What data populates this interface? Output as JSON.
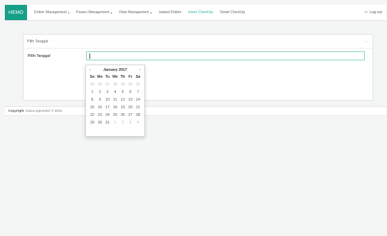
{
  "navbar": {
    "brand": "HEMO",
    "items": [
      {
        "label": "Dokter Management",
        "dropdown": true
      },
      {
        "label": "Pasien Management",
        "dropdown": true
      },
      {
        "label": "Obat Management",
        "dropdown": true
      },
      {
        "label": "Jadwal Dokter",
        "dropdown": false
      },
      {
        "label": "Insert CheckUp",
        "dropdown": false,
        "active": true
      },
      {
        "label": "Detail CheckUp",
        "dropdown": false
      }
    ],
    "caret": "▾",
    "logout": {
      "label": "Log out",
      "icon": "logout-icon",
      "glyph": "⇨"
    }
  },
  "panel": {
    "title": "Pilih Tanggal",
    "collapse_glyph": "︿",
    "field_label": "Pilih Tanggal",
    "field_value": ""
  },
  "datepicker": {
    "month_label": "January 2017",
    "prev": "‹",
    "next": "›",
    "dow": [
      "Su",
      "Mo",
      "Tu",
      "We",
      "Th",
      "Fr",
      "Sa"
    ],
    "weeks": [
      [
        "25",
        "26",
        "27",
        "28",
        "29",
        "30",
        "31"
      ],
      [
        "1",
        "2",
        "3",
        "4",
        "5",
        "6",
        "7"
      ],
      [
        "8",
        "9",
        "10",
        "11",
        "12",
        "13",
        "14"
      ],
      [
        "15",
        "16",
        "17",
        "18",
        "19",
        "20",
        "21"
      ],
      [
        "22",
        "23",
        "24",
        "25",
        "26",
        "27",
        "28"
      ],
      [
        "29",
        "30",
        "31",
        "1",
        "2",
        "3",
        "4"
      ]
    ],
    "other_month": [
      [
        true,
        true,
        true,
        true,
        true,
        true,
        true
      ],
      [
        false,
        false,
        false,
        false,
        false,
        false,
        false
      ],
      [
        false,
        false,
        false,
        false,
        false,
        false,
        false
      ],
      [
        false,
        false,
        false,
        false,
        false,
        false,
        false
      ],
      [
        false,
        false,
        false,
        false,
        false,
        false,
        false
      ],
      [
        false,
        false,
        false,
        true,
        true,
        true,
        true
      ]
    ]
  },
  "footer": {
    "copyright_label": "Copyright",
    "text": "zaisou.sgmacker © 2015"
  },
  "colors": {
    "accent": "#17a089",
    "active_link": "#2fb39b",
    "input_border": "#7fd0bf"
  }
}
